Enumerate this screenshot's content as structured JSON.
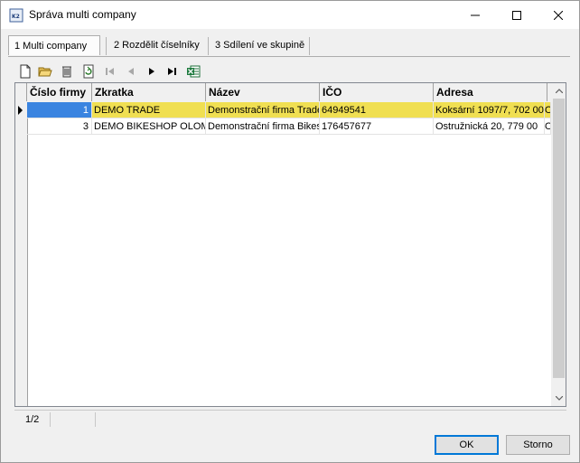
{
  "window": {
    "title": "Správa multi company",
    "colors": {
      "title_bg": "#ffffff",
      "accent": "#0078d7",
      "selected_row": "#f0df52",
      "selected_cell": "#3a84e0"
    }
  },
  "tabs": [
    {
      "label": "1 Multi company",
      "active": true
    },
    {
      "label": "2 Rozdělit číselníky",
      "active": false
    },
    {
      "label": "3 Sdílení ve skupině",
      "active": false
    }
  ],
  "toolbar": {
    "icons": [
      "new-document-icon",
      "open-folder-icon",
      "delete-icon",
      "refresh-icon",
      "first-record-icon",
      "previous-record-icon",
      "next-record-icon",
      "last-record-icon",
      "excel-export-icon"
    ]
  },
  "grid": {
    "columns": [
      "Číslo firmy",
      "Zkratka",
      "Název",
      "IČO",
      "Adresa"
    ],
    "rows": [
      {
        "cislo": "1",
        "zkratka": "DEMO TRADE",
        "nazev": "Demonstrační firma Trade",
        "ico": "64949541",
        "adresa": "Koksární 1097/7, 702 00",
        "extra": "O",
        "selected": true
      },
      {
        "cislo": "3",
        "zkratka": "DEMO BIKESHOP OLOMOUC",
        "nazev": "Demonstrační firma Bikeshop",
        "ico": "176457677",
        "adresa": "Ostružnická 20, 779 00",
        "extra": "O",
        "selected": false
      }
    ]
  },
  "status": {
    "record": "1/2"
  },
  "buttons": {
    "ok": "OK",
    "cancel": "Storno"
  }
}
